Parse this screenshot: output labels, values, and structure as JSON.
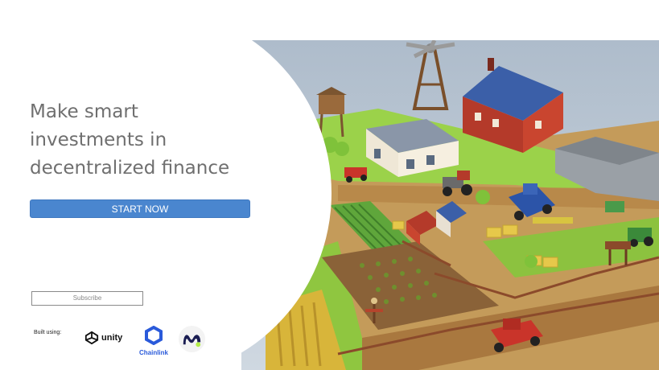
{
  "hero": {
    "headline_lines": [
      "Make smart",
      "investments in",
      "decentralized finance"
    ],
    "cta_label": "START NOW"
  },
  "subscribe": {
    "placeholder": "Subscribe"
  },
  "footer": {
    "built_label": "Built using:",
    "logos": [
      {
        "icon": "unity-logo-icon",
        "label": "unity"
      },
      {
        "icon": "chainlink-logo-icon",
        "label": "Chainlink"
      },
      {
        "icon": "moralis-logo-icon",
        "label": ""
      }
    ]
  },
  "colors": {
    "cta": "#4a86cf",
    "headline": "#6f6f6f",
    "sky": "#b7c4d2",
    "grass": "#9bd24a"
  },
  "illustration": {
    "name": "isometric-farm-illustration",
    "icons": [
      "windmill-icon",
      "water-tower-icon",
      "farmhouse-icon",
      "barn-icon",
      "tractor-icon",
      "harvester-icon",
      "pickup-truck-icon",
      "scarecrow-icon",
      "fence-icon",
      "crop-field-icon",
      "hay-bale-icon",
      "signpost-icon"
    ]
  }
}
